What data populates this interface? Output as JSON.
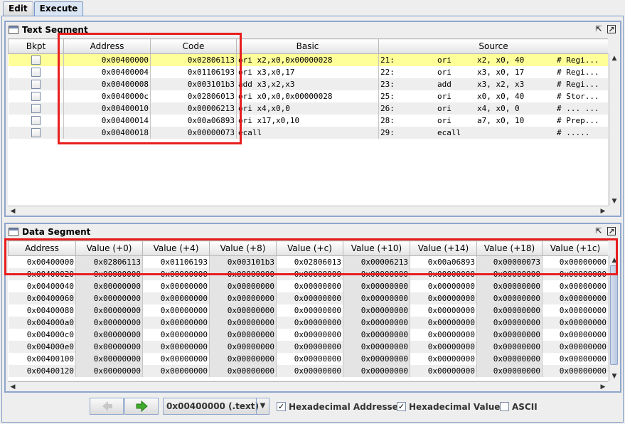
{
  "tabs": [
    "Edit",
    "Execute"
  ],
  "text_segment": {
    "title": "Text Segment",
    "columns": [
      "Bkpt",
      "Address",
      "Code",
      "Basic",
      "Source"
    ],
    "rows": [
      {
        "address": "0x00400000",
        "code": "0x02806113",
        "basic": "ori x2,x0,0x00000028",
        "line": "21:",
        "op": "ori",
        "args": "x2, x0, 40",
        "comment": "# Regi..."
      },
      {
        "address": "0x00400004",
        "code": "0x01106193",
        "basic": "ori x3,x0,17",
        "line": "22:",
        "op": "ori",
        "args": "x3, x0, 17",
        "comment": "# Regi..."
      },
      {
        "address": "0x00400008",
        "code": "0x003101b3",
        "basic": "add x3,x2,x3",
        "line": "23:",
        "op": "add",
        "args": "x3, x2, x3",
        "comment": "# Regi..."
      },
      {
        "address": "0x0040000c",
        "code": "0x02806013",
        "basic": "ori x0,x0,0x00000028",
        "line": "25:",
        "op": "ori",
        "args": "x0, x0, 40",
        "comment": "# Stor..."
      },
      {
        "address": "0x00400010",
        "code": "0x00006213",
        "basic": "ori x4,x0,0",
        "line": "26:",
        "op": "ori",
        "args": "x4, x0, 0",
        "comment": "# ... ..."
      },
      {
        "address": "0x00400014",
        "code": "0x00a06893",
        "basic": "ori x17,x0,10",
        "line": "28:",
        "op": "ori",
        "args": "a7, x0, 10",
        "comment": "# Prep..."
      },
      {
        "address": "0x00400018",
        "code": "0x00000073",
        "basic": "ecall",
        "line": "29:",
        "op": "ecall",
        "args": "",
        "comment": "#   ....."
      }
    ]
  },
  "data_segment": {
    "title": "Data Segment",
    "columns": [
      "Address",
      "Value (+0)",
      "Value (+4)",
      "Value (+8)",
      "Value (+c)",
      "Value (+10)",
      "Value (+14)",
      "Value (+18)",
      "Value (+1c)"
    ],
    "rows": [
      {
        "address": "0x00400000",
        "values": [
          "0x02806113",
          "0x01106193",
          "0x003101b3",
          "0x02806013",
          "0x00006213",
          "0x00a06893",
          "0x00000073",
          "0x00000000"
        ]
      },
      {
        "address": "0x00400020",
        "values": [
          "0x00000000",
          "0x00000000",
          "0x00000000",
          "0x00000000",
          "0x00000000",
          "0x00000000",
          "0x00000000",
          "0x00000000"
        ]
      },
      {
        "address": "0x00400040",
        "values": [
          "0x00000000",
          "0x00000000",
          "0x00000000",
          "0x00000000",
          "0x00000000",
          "0x00000000",
          "0x00000000",
          "0x00000000"
        ]
      },
      {
        "address": "0x00400060",
        "values": [
          "0x00000000",
          "0x00000000",
          "0x00000000",
          "0x00000000",
          "0x00000000",
          "0x00000000",
          "0x00000000",
          "0x00000000"
        ]
      },
      {
        "address": "0x00400080",
        "values": [
          "0x00000000",
          "0x00000000",
          "0x00000000",
          "0x00000000",
          "0x00000000",
          "0x00000000",
          "0x00000000",
          "0x00000000"
        ]
      },
      {
        "address": "0x004000a0",
        "values": [
          "0x00000000",
          "0x00000000",
          "0x00000000",
          "0x00000000",
          "0x00000000",
          "0x00000000",
          "0x00000000",
          "0x00000000"
        ]
      },
      {
        "address": "0x004000c0",
        "values": [
          "0x00000000",
          "0x00000000",
          "0x00000000",
          "0x00000000",
          "0x00000000",
          "0x00000000",
          "0x00000000",
          "0x00000000"
        ]
      },
      {
        "address": "0x004000e0",
        "values": [
          "0x00000000",
          "0x00000000",
          "0x00000000",
          "0x00000000",
          "0x00000000",
          "0x00000000",
          "0x00000000",
          "0x00000000"
        ]
      },
      {
        "address": "0x00400100",
        "values": [
          "0x00000000",
          "0x00000000",
          "0x00000000",
          "0x00000000",
          "0x00000000",
          "0x00000000",
          "0x00000000",
          "0x00000000"
        ]
      },
      {
        "address": "0x00400120",
        "values": [
          "0x00000000",
          "0x00000000",
          "0x00000000",
          "0x00000000",
          "0x00000000",
          "0x00000000",
          "0x00000000",
          "0x00000000"
        ]
      }
    ]
  },
  "bottom": {
    "address_select": "0x00400000 (.text)",
    "hex_addresses_label": "Hexadecimal Addresses",
    "hex_addresses_checked": true,
    "hex_values_label": "Hexadecimal Values",
    "hex_values_checked": true,
    "ascii_label": "ASCII",
    "ascii_checked": false
  },
  "colors": {
    "highlight_row": "#ffff99",
    "annotation_box": "#e81e1e",
    "frame_border": "#8ea6cc"
  }
}
